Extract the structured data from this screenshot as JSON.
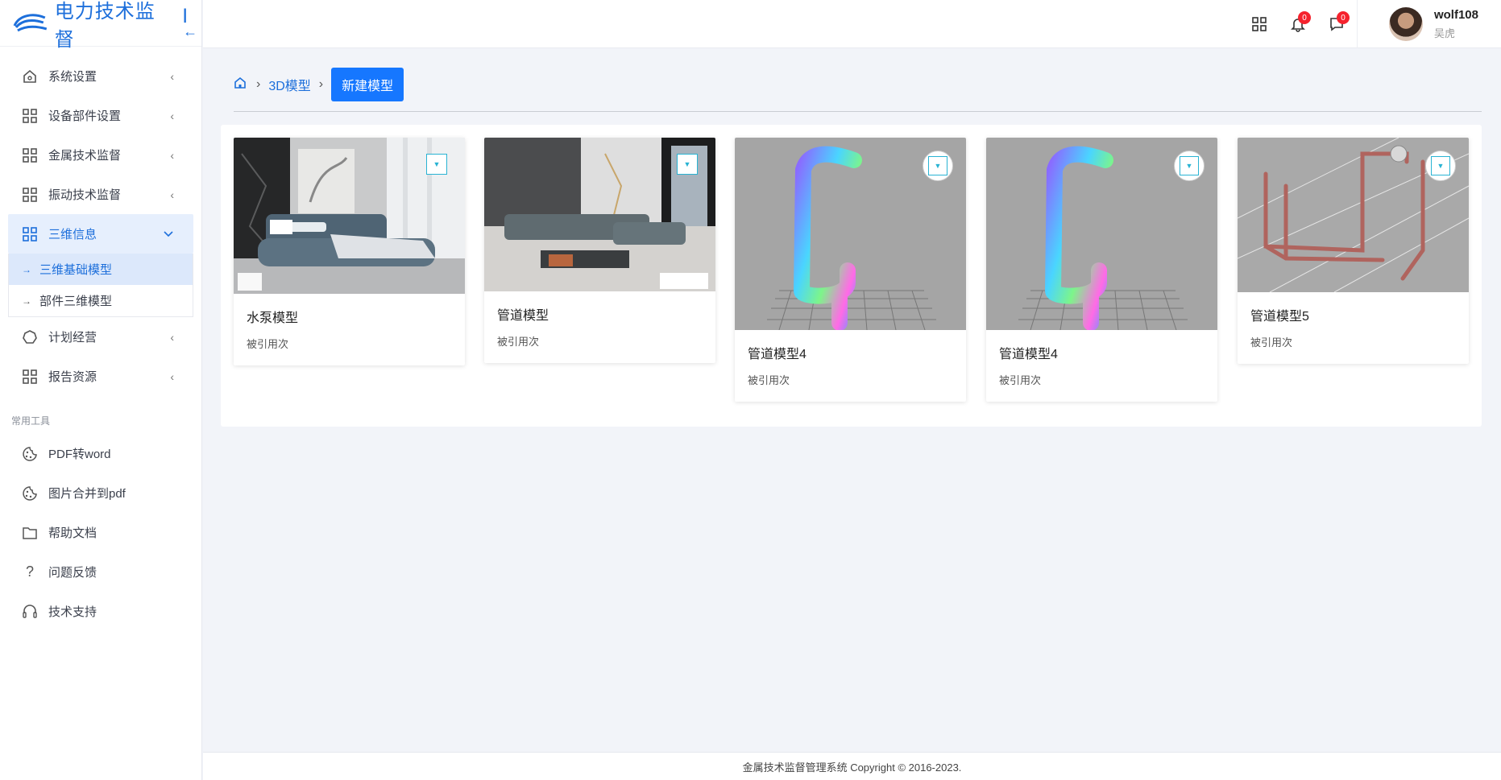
{
  "brand": {
    "title": "电力技术监督",
    "collapse_icon": "collapse-left-icon"
  },
  "sidebar": {
    "items": [
      {
        "label": "系统设置",
        "icon": "home-settings-icon"
      },
      {
        "label": "设备部件设置",
        "icon": "grid-icon"
      },
      {
        "label": "金属技术监督",
        "icon": "grid-icon"
      },
      {
        "label": "振动技术监督",
        "icon": "grid-icon"
      },
      {
        "label": "三维信息",
        "icon": "grid-icon",
        "active": true
      },
      {
        "label": "计划经营",
        "icon": "circle-icon"
      },
      {
        "label": "报告资源",
        "icon": "grid-icon"
      }
    ],
    "submenu": [
      {
        "label": "三维基础模型",
        "active": true
      },
      {
        "label": "部件三维模型"
      }
    ],
    "tools_title": "常用工具",
    "tools": [
      {
        "label": "PDF转word",
        "icon": "palette-icon"
      },
      {
        "label": "图片合并到pdf",
        "icon": "palette-icon"
      },
      {
        "label": "帮助文档",
        "icon": "folder-icon"
      },
      {
        "label": "问题反馈",
        "icon": "question-icon"
      },
      {
        "label": "技术支持",
        "icon": "headset-icon"
      }
    ]
  },
  "header": {
    "apps_icon": "apps-grid-icon",
    "notifications": {
      "icon": "bell-icon",
      "count": "0"
    },
    "messages": {
      "icon": "message-icon",
      "count": "0"
    },
    "user": {
      "name": "wolf108",
      "subtitle": "吴虎"
    }
  },
  "breadcrumb": {
    "home_icon": "home-icon",
    "items": [
      "3D模型"
    ],
    "current": "新建模型"
  },
  "cards": [
    {
      "title": "水泵模型",
      "meta": "被引用次",
      "thumb": "bedroom"
    },
    {
      "title": "管道模型",
      "meta": "被引用次",
      "thumb": "sofa"
    },
    {
      "title": "管道模型4",
      "meta": "被引用次",
      "thumb": "pipe"
    },
    {
      "title": "管道模型4",
      "meta": "被引用次",
      "thumb": "pipe"
    },
    {
      "title": "管道模型5",
      "meta": "被引用次",
      "thumb": "frame"
    }
  ],
  "footer": {
    "text": "金属技术监督管理系统 Copyright © 2016-2023."
  }
}
